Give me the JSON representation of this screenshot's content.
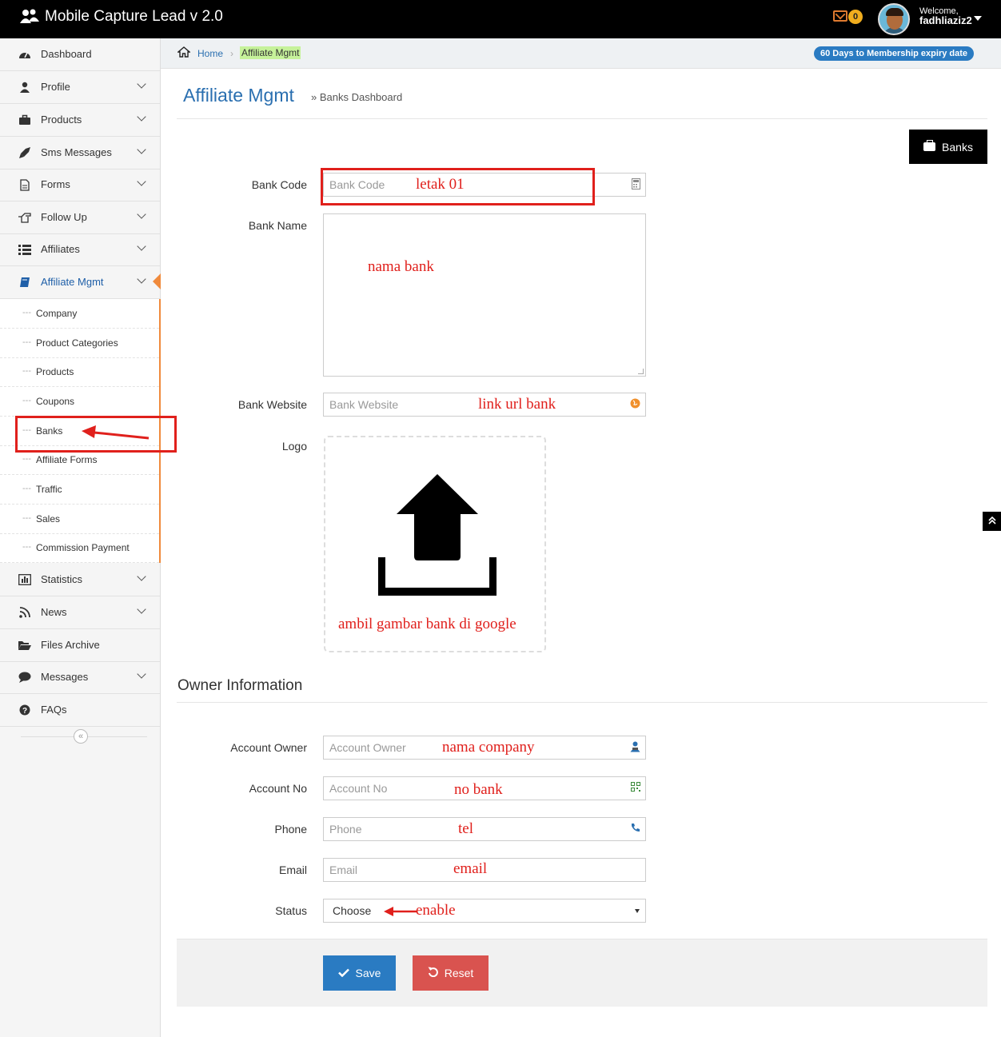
{
  "app": {
    "title": "Mobile Capture Lead v 2.0"
  },
  "header": {
    "mail_count": "0",
    "welcome": "Welcome,",
    "username": "fadhliaziz2"
  },
  "breadcrumb": {
    "home": "Home",
    "separator": "›",
    "current": "Affiliate Mgmt"
  },
  "membership": {
    "expiry_text": "60 Days to Membership expiry date"
  },
  "sidebar": {
    "items": [
      {
        "label": "Dashboard",
        "icon": "dashboard-icon"
      },
      {
        "label": "Profile",
        "icon": "user-icon"
      },
      {
        "label": "Products",
        "icon": "briefcase-icon"
      },
      {
        "label": "Sms Messages",
        "icon": "rocket-icon"
      },
      {
        "label": "Forms",
        "icon": "file-icon"
      },
      {
        "label": "Follow Up",
        "icon": "hand-pointer-icon"
      },
      {
        "label": "Affiliates",
        "icon": "list-icon"
      },
      {
        "label": "Affiliate Mgmt",
        "icon": "book-icon"
      },
      {
        "label": "Statistics",
        "icon": "bar-chart-icon"
      },
      {
        "label": "News",
        "icon": "rss-icon"
      },
      {
        "label": "Files Archive",
        "icon": "folder-open-icon"
      },
      {
        "label": "Messages",
        "icon": "comment-icon"
      },
      {
        "label": "FAQs",
        "icon": "question-circle-icon"
      }
    ],
    "submenu": [
      "Company",
      "Product Categories",
      "Products",
      "Coupons",
      "Banks",
      "Affiliate Forms",
      "Traffic",
      "Sales",
      "Commission Payment"
    ],
    "collapse_glyph": "«"
  },
  "page": {
    "title": "Affiliate Mgmt",
    "subtitle": "» Banks Dashboard",
    "banks_button": "Banks",
    "owner_section_title": "Owner Information"
  },
  "form": {
    "bank_code": {
      "label": "Bank Code",
      "placeholder": "Bank Code"
    },
    "bank_name": {
      "label": "Bank Name"
    },
    "bank_website": {
      "label": "Bank Website",
      "placeholder": "Bank Website"
    },
    "logo": {
      "label": "Logo"
    },
    "account_owner": {
      "label": "Account Owner",
      "placeholder": "Account Owner"
    },
    "account_no": {
      "label": "Account No",
      "placeholder": "Account No"
    },
    "phone": {
      "label": "Phone",
      "placeholder": "Phone"
    },
    "email": {
      "label": "Email",
      "placeholder": "Email"
    },
    "status": {
      "label": "Status",
      "selected": "Choose"
    },
    "save_label": "Save",
    "reset_label": "Reset"
  },
  "annotations": {
    "bank_code": "letak 01",
    "bank_name": "nama bank",
    "bank_website": "link url bank",
    "logo": "ambil gambar bank di google",
    "account_owner": "nama company",
    "account_no": "no bank",
    "phone": "tel",
    "email": "email",
    "status": "enable"
  },
  "colors": {
    "accent": "#2a6fb0",
    "save": "#2a7bc2",
    "reset": "#d9534f",
    "annotation": "#e0201c",
    "menu_active_border": "#f08a3c"
  }
}
